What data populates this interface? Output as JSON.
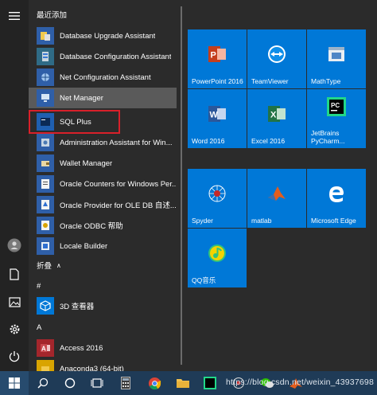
{
  "colors": {
    "tile_blue": "#0078d7",
    "rail_bg": "#232323",
    "menu_bg": "#2b2b2b",
    "taskbar_bg": "#1f3b57",
    "highlight_red": "#d9202a",
    "hover_bg": "#5a5a5a"
  },
  "applist": {
    "recent_header": "最近添加",
    "items": [
      {
        "label": "Database Upgrade Assistant",
        "icon": "database-upgrade-icon"
      },
      {
        "label": "Database Configuration Assistant",
        "icon": "database-config-icon"
      },
      {
        "label": "Net Configuration Assistant",
        "icon": "net-config-icon"
      },
      {
        "label": "Net Manager",
        "icon": "net-manager-icon"
      },
      {
        "label": "SQL Plus",
        "icon": "sqlplus-icon"
      },
      {
        "label": "Administration Assistant for Win...",
        "icon": "admin-assistant-icon"
      },
      {
        "label": "Wallet Manager",
        "icon": "wallet-manager-icon"
      },
      {
        "label": "Oracle Counters for Windows Per...",
        "icon": "oracle-counters-icon"
      },
      {
        "label": "Oracle Provider for OLE DB 自述...",
        "icon": "oracle-provider-icon"
      },
      {
        "label": "Oracle ODBC 帮助",
        "icon": "oracle-odbc-icon"
      },
      {
        "label": "Locale Builder",
        "icon": "locale-builder-icon"
      }
    ],
    "collapse_label": "折叠",
    "section_hash": "#",
    "hash_items": [
      {
        "label": "3D 查看器",
        "icon": "3d-viewer-icon"
      }
    ],
    "section_a": "A",
    "a_items": [
      {
        "label": "Access 2016",
        "icon": "access-icon"
      },
      {
        "label": "Anaconda3 (64-bit)",
        "icon": "anaconda-icon"
      }
    ]
  },
  "tiles": [
    {
      "label": "PowerPoint 2016",
      "icon": "powerpoint-icon"
    },
    {
      "label": "TeamViewer",
      "icon": "teamviewer-icon"
    },
    {
      "label": "MathType",
      "icon": "mathtype-icon"
    },
    {
      "label": "Word 2016",
      "icon": "word-icon"
    },
    {
      "label": "Excel 2016",
      "icon": "excel-icon"
    },
    {
      "label": "JetBrains PyCharm...",
      "icon": "pycharm-icon"
    },
    {
      "label": "Spyder",
      "icon": "spyder-icon"
    },
    {
      "label": "matlab",
      "icon": "matlab-icon"
    },
    {
      "label": "Microsoft Edge",
      "icon": "edge-icon"
    },
    {
      "label": "QQ音乐",
      "icon": "qqmusic-icon"
    }
  ],
  "taskbar": {
    "watermark": "https://blog.csdn.net/weixin_43937698"
  }
}
